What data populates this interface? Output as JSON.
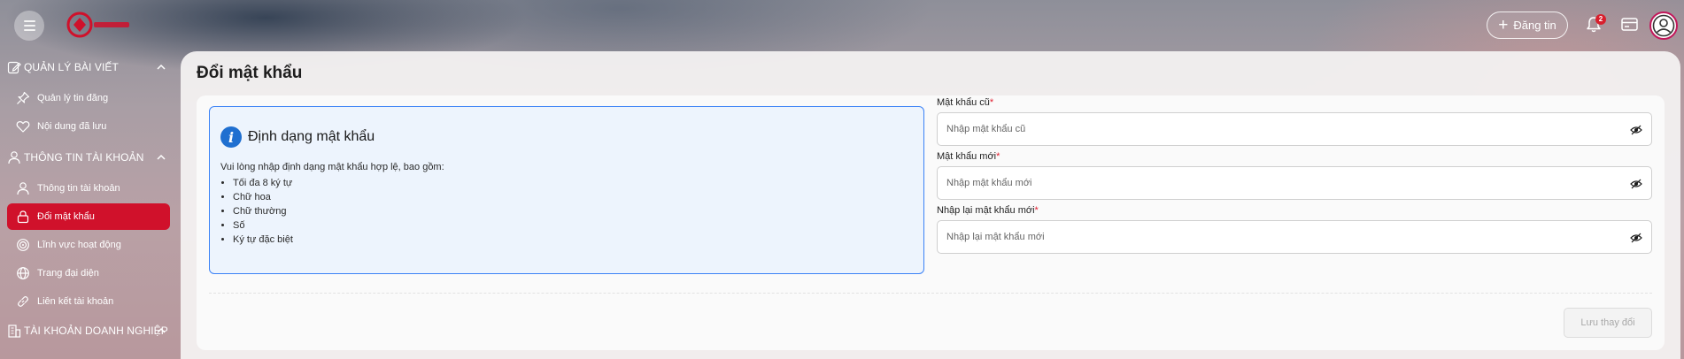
{
  "header": {
    "login_label": "Đăng tin",
    "notification_count": "2",
    "icons": [
      "menu-icon",
      "logo",
      "plus-icon",
      "bell-icon",
      "card-icon",
      "user-icon"
    ]
  },
  "sidebar": {
    "sections": [
      {
        "label": "QUẢN LÝ BÀI VIẾT",
        "icon": "edit-icon"
      },
      {
        "label": "THÔNG TIN TÀI KHOẢN",
        "icon": "user-icon"
      },
      {
        "label": "TÀI KHOẢN DOANH NGHIỆP",
        "icon": "building-icon"
      }
    ],
    "items": [
      {
        "label": "Quản lý tin đăng",
        "icon": "pin-icon"
      },
      {
        "label": "Nội dung đã lưu",
        "icon": "heart-icon"
      },
      {
        "label": "Thông tin tài khoản",
        "icon": "user-icon"
      },
      {
        "label": "Đổi mật khẩu",
        "icon": "lock-icon",
        "active": true
      },
      {
        "label": "Lĩnh vực hoạt động",
        "icon": "target-icon"
      },
      {
        "label": "Trang đại diện",
        "icon": "globe-icon"
      },
      {
        "label": "Liên kết tài khoản",
        "icon": "link-icon"
      }
    ]
  },
  "main": {
    "title": "Đổi mật khẩu",
    "info": {
      "title": "Định dạng mật khẩu",
      "intro": "Vui lòng nhập định dạng mật khẩu hợp lệ, bao gồm:",
      "rules": [
        "Tối đa 8 ký tự",
        "Chữ hoa",
        "Chữ thường",
        "Số",
        "Ký tự đặc biệt"
      ]
    },
    "fields": [
      {
        "label": "Mật khẩu cũ",
        "required": "*",
        "placeholder": "Nhập mật khẩu cũ"
      },
      {
        "label": "Mật khẩu mới",
        "required": "*",
        "placeholder": "Nhập mật khẩu mới"
      },
      {
        "label": "Nhập lại mật khẩu mới",
        "required": "*",
        "placeholder": "Nhập lại mật khẩu mới"
      }
    ],
    "save_label": "Lưu thay đổi"
  },
  "colors": {
    "accent": "#d0112b",
    "info_border": "#3b82f6",
    "info_bg": "#edf4fd",
    "required": "#e11d2e"
  }
}
